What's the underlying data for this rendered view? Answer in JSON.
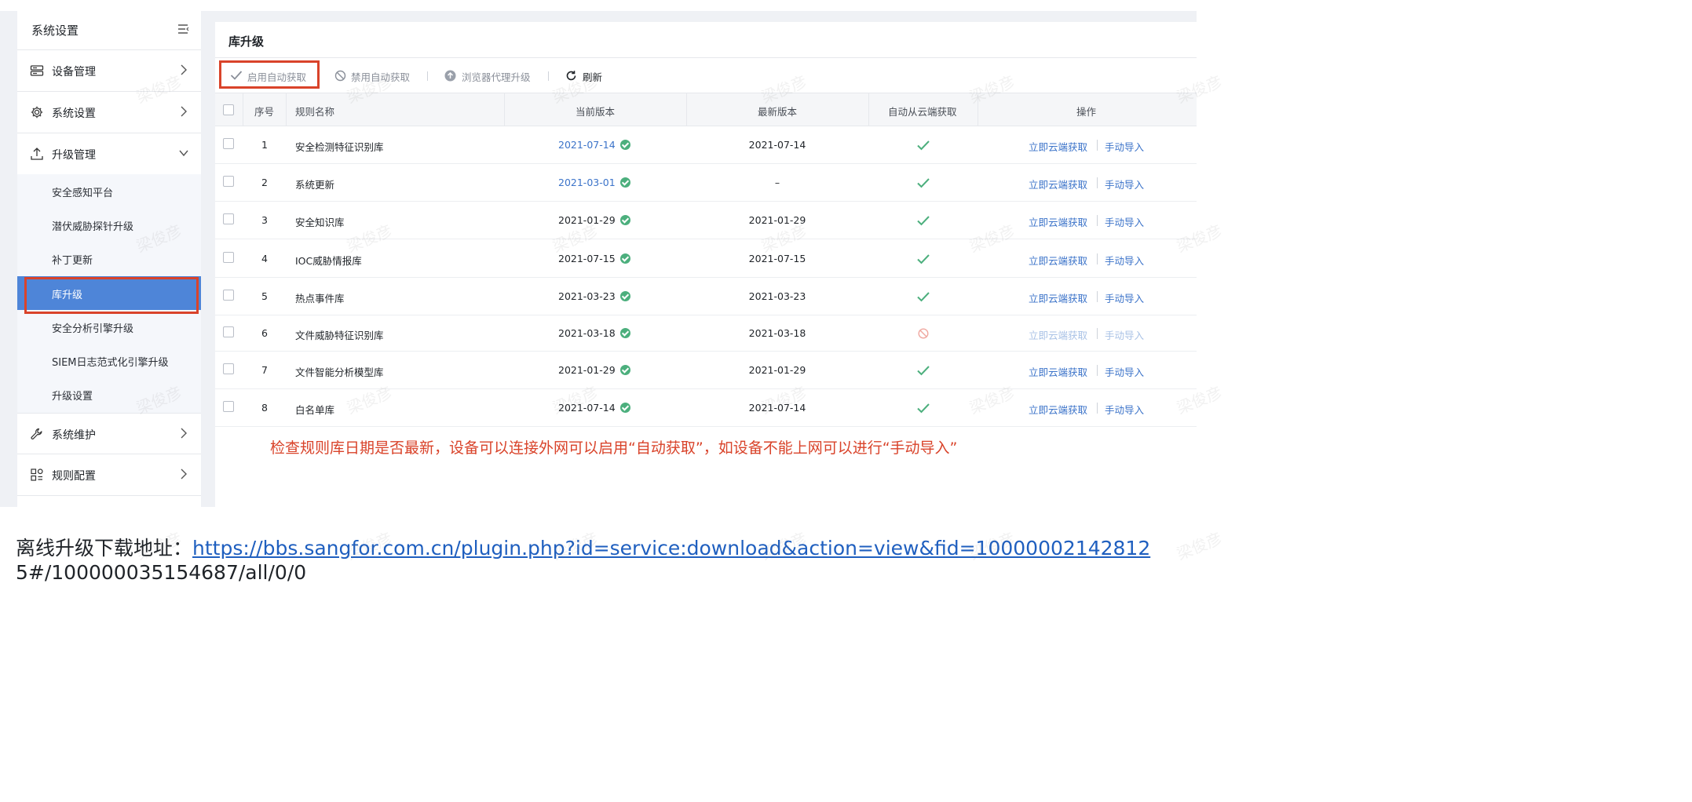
{
  "sidebar": {
    "title": "系统设置",
    "main_items": [
      {
        "label": "设备管理",
        "icon": "server-icon",
        "expanded": false
      },
      {
        "label": "系统设置",
        "icon": "gear-icon",
        "expanded": false
      },
      {
        "label": "升级管理",
        "icon": "upload-icon",
        "expanded": true
      },
      {
        "label": "系统维护",
        "icon": "wrench-icon",
        "expanded": false
      },
      {
        "label": "规则配置",
        "icon": "grid-list-icon",
        "expanded": false
      }
    ],
    "sub_items": [
      {
        "label": "安全感知平台"
      },
      {
        "label": "潜伏威胁探针升级"
      },
      {
        "label": "补丁更新"
      },
      {
        "label": "库升级",
        "active": true
      },
      {
        "label": "安全分析引擎升级"
      },
      {
        "label": "SIEM日志范式化引擎升级"
      },
      {
        "label": "升级设置"
      }
    ]
  },
  "page": {
    "title": "库升级",
    "toolbar": {
      "enable_auto": "启用自动获取",
      "disable_auto": "禁用自动获取",
      "proxy_upgrade": "浏览器代理升级",
      "refresh": "刷新"
    },
    "columns": [
      "序号",
      "规则名称",
      "当前版本",
      "最新版本",
      "自动从云端获取",
      "操作"
    ],
    "rows": [
      {
        "no": "1",
        "name": "安全检测特征识别库",
        "current": "2021-07-14",
        "current_highlight": true,
        "latest": "2021-07-14",
        "auto": true,
        "op1": "立即云端获取",
        "op2": "手动导入"
      },
      {
        "no": "2",
        "name": "系统更新",
        "current": "2021-03-01",
        "current_highlight": true,
        "latest": "–",
        "auto": true,
        "op1": "立即云端获取",
        "op2": "手动导入"
      },
      {
        "no": "3",
        "name": "安全知识库",
        "current": "2021-01-29",
        "current_highlight": false,
        "latest": "2021-01-29",
        "auto": true,
        "op1": "立即云端获取",
        "op2": "手动导入"
      },
      {
        "no": "4",
        "name": "IOC威胁情报库",
        "current": "2021-07-15",
        "current_highlight": false,
        "latest": "2021-07-15",
        "auto": true,
        "op1": "立即云端获取",
        "op2": "手动导入"
      },
      {
        "no": "5",
        "name": "热点事件库",
        "current": "2021-03-23",
        "current_highlight": false,
        "latest": "2021-03-23",
        "auto": true,
        "op1": "立即云端获取",
        "op2": "手动导入"
      },
      {
        "no": "6",
        "name": "文件威胁特征识别库",
        "current": "2021-03-18",
        "current_highlight": false,
        "latest": "2021-03-18",
        "auto": false,
        "op1": "立即云端获取",
        "op2": "手动导入"
      },
      {
        "no": "7",
        "name": "文件智能分析模型库",
        "current": "2021-01-29",
        "current_highlight": false,
        "latest": "2021-01-29",
        "auto": true,
        "op1": "立即云端获取",
        "op2": "手动导入"
      },
      {
        "no": "8",
        "name": "白名单库",
        "current": "2021-07-14",
        "current_highlight": false,
        "latest": "2021-07-14",
        "auto": true,
        "op1": "立即云端获取",
        "op2": "手动导入"
      }
    ],
    "annotation": "检查规则库日期是否最新，设备可以连接外网可以启用“自动获取”，如设备不能上网可以进行“手动导入”"
  },
  "footer": {
    "label": "离线升级下载地址：",
    "link": "https://bbs.sangfor.com.cn/plugin.php?id=service:download&action=view&fid=10000002142812",
    "link_cont": "5#/100000035154687/all/0/0"
  },
  "watermark": "梁俊彦",
  "colors": {
    "accent": "#4e85d8",
    "link": "#3b73c9",
    "annotation": "#d9432a",
    "ok": "#4caf7d",
    "disabled": "#f0a8a0"
  }
}
